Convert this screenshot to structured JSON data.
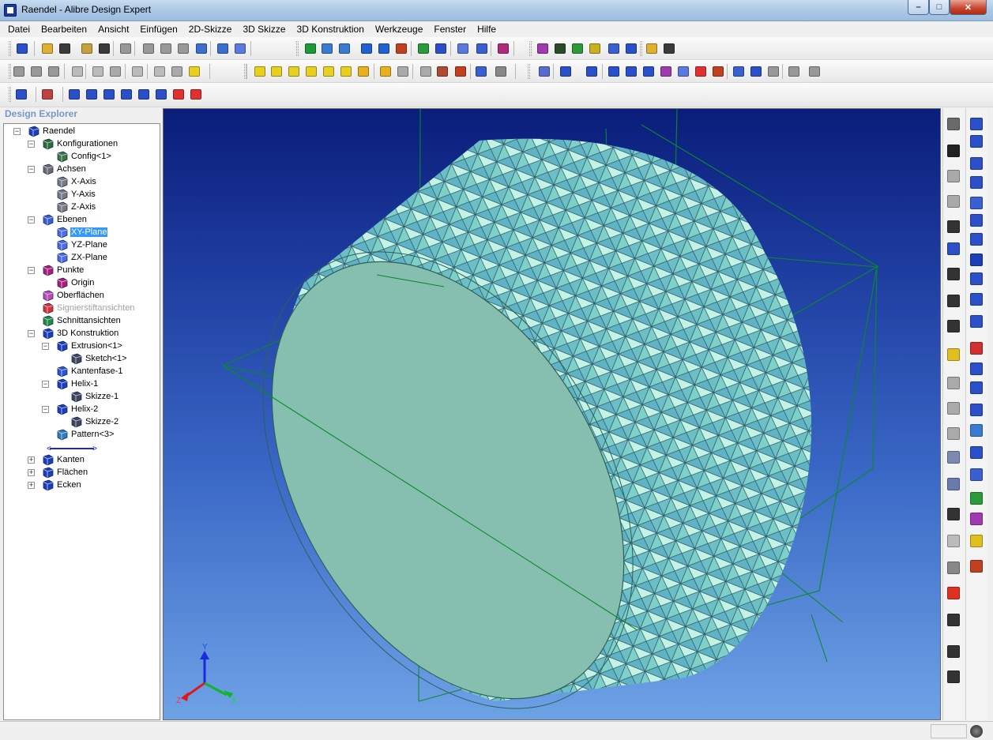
{
  "window": {
    "title": "Raendel - Alibre Design Expert"
  },
  "menu": [
    "Datei",
    "Bearbeiten",
    "Ansicht",
    "Einfügen",
    "2D-Skizze",
    "3D Skizze",
    "3D Konstruktion",
    "Werkzeuge",
    "Fenster",
    "Hilfe"
  ],
  "explorer": {
    "title": "Design Explorer",
    "tree": [
      {
        "label": "Raendel",
        "icon": "part-icon",
        "toggle": "−",
        "selected": false,
        "disabled": false
      },
      {
        "label": "Konfigurationen",
        "icon": "configurations-icon",
        "toggle": "−"
      },
      {
        "label": "Config<1>",
        "icon": "config-icon"
      },
      {
        "label": "Achsen",
        "icon": "axes-icon",
        "toggle": "−"
      },
      {
        "label": "X-Axis",
        "icon": "axis-icon"
      },
      {
        "label": "Y-Axis",
        "icon": "axis-icon"
      },
      {
        "label": "Z-Axis",
        "icon": "axis-icon"
      },
      {
        "label": "Ebenen",
        "icon": "planes-icon",
        "toggle": "−"
      },
      {
        "label": "XY-Plane",
        "icon": "plane-icon",
        "selected": true
      },
      {
        "label": "YZ-Plane",
        "icon": "plane-icon"
      },
      {
        "label": "ZX-Plane",
        "icon": "plane-icon"
      },
      {
        "label": "Punkte",
        "icon": "points-icon",
        "toggle": "−"
      },
      {
        "label": "Origin",
        "icon": "origin-icon"
      },
      {
        "label": "Oberflächen",
        "icon": "surfaces-icon"
      },
      {
        "label": "Signierstiftansichten",
        "icon": "markup-views-icon",
        "disabled": true
      },
      {
        "label": "Schnittansichten",
        "icon": "section-views-icon"
      },
      {
        "label": "3D Konstruktion",
        "icon": "construction-icon",
        "toggle": "−"
      },
      {
        "label": "Extrusion<1>",
        "icon": "extrusion-icon",
        "toggle": "−"
      },
      {
        "label": "Sketch<1>",
        "icon": "sketch-icon"
      },
      {
        "label": "Kantenfase-1",
        "icon": "chamfer-icon"
      },
      {
        "label": "Helix-1",
        "icon": "helix-icon",
        "toggle": "−"
      },
      {
        "label": "Skizze-1",
        "icon": "sketch-icon"
      },
      {
        "label": "Helix-2",
        "icon": "helix-icon",
        "toggle": "−"
      },
      {
        "label": "Skizze-2",
        "icon": "sketch-icon"
      },
      {
        "label": "Pattern<3>",
        "icon": "pattern-icon"
      },
      {
        "label": "Kanten",
        "icon": "edges-icon",
        "toggle": "+"
      },
      {
        "label": "Flächen",
        "icon": "faces-icon",
        "toggle": "+"
      },
      {
        "label": "Ecken",
        "icon": "vertices-icon",
        "toggle": "+"
      }
    ]
  },
  "triad": {
    "x_label": "X",
    "y_label": "Y",
    "z_label": "Z"
  },
  "colors": {
    "part_face": "#86bfb0",
    "knurl": "#9ee6d4",
    "knurl_shade": "#4a8fa8",
    "plane_line": "#0a8a2a",
    "viewport_top": "#0a1d7a",
    "viewport_bottom": "#6ea2e6",
    "selection": "#3399ff"
  }
}
